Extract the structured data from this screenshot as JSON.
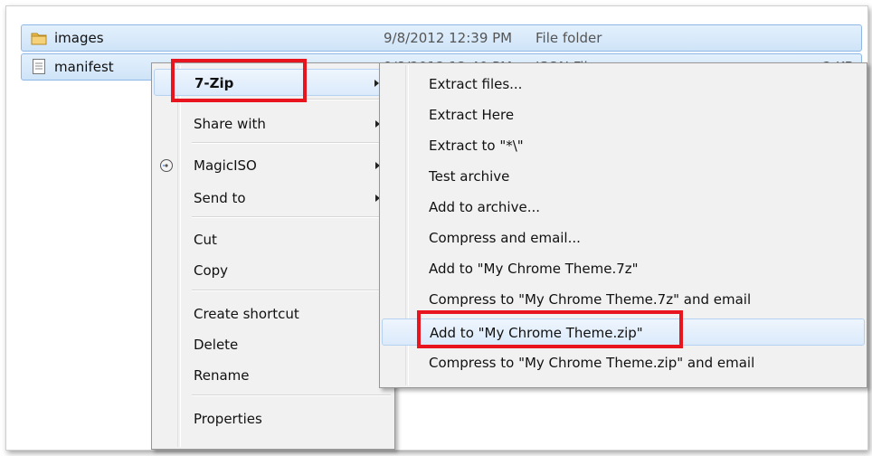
{
  "files": [
    {
      "name": "images",
      "date": "9/8/2012 12:39 PM",
      "type": "File folder",
      "size": "",
      "icon": "folder-icon"
    },
    {
      "name": "manifest",
      "date": "9/8/2012 12:40 PM",
      "type": "JSON File",
      "size": "2 KB",
      "icon": "document-icon"
    }
  ],
  "context_menu": {
    "items": {
      "zip": "7-Zip",
      "share_with": "Share with",
      "magiciso": "MagicISO",
      "send_to": "Send to",
      "cut": "Cut",
      "copy": "Copy",
      "create_shortcut": "Create shortcut",
      "delete": "Delete",
      "rename": "Rename",
      "properties": "Properties"
    }
  },
  "zip_submenu": {
    "items": [
      "Extract files...",
      "Extract Here",
      "Extract to \"*\\\"",
      "Test archive",
      "Add to archive...",
      "Compress and email...",
      "Add to \"My Chrome Theme.7z\"",
      "Compress to \"My Chrome Theme.7z\" and email",
      "Add to \"My Chrome Theme.zip\"",
      "Compress to \"My Chrome Theme.zip\" and email"
    ],
    "highlighted_index": 8
  },
  "colors": {
    "highlight_box": "#e8141e",
    "selection": "#cfe4f8"
  }
}
